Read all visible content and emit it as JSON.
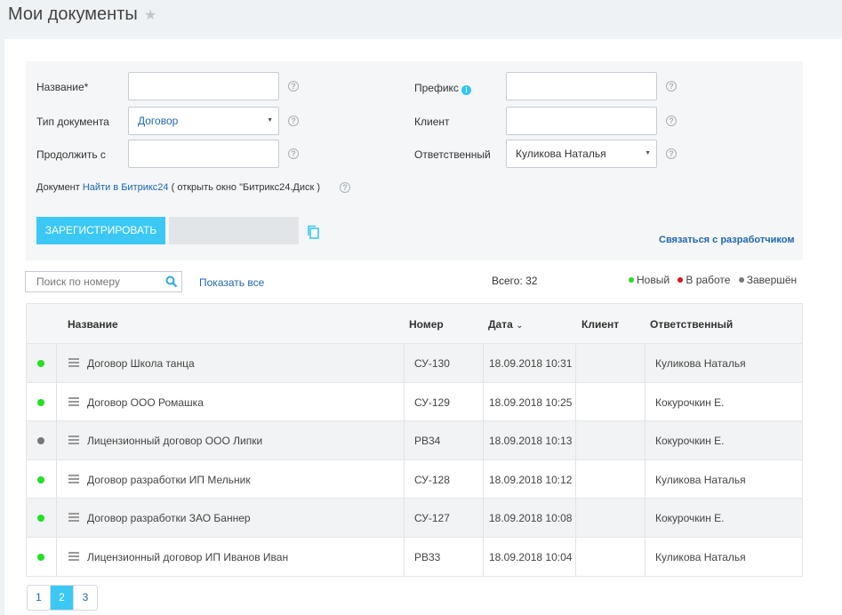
{
  "header": {
    "title": "Мои документы"
  },
  "form": {
    "name_label": "Название*",
    "name_value": "",
    "doc_type_label": "Тип документа",
    "doc_type_value": "Договор",
    "continue_label": "Продолжить с",
    "continue_value": "",
    "prefix_label": "Префикс",
    "prefix_value": "",
    "client_label": "Клиент",
    "client_value": "",
    "responsible_label": "Ответственный",
    "responsible_value": "Куликова Наталья",
    "document_label": "Документ",
    "find_link": "Найти в Битрикс24",
    "open_window_text": "( открыть окно \"Битрикс24.Диск )",
    "register_button": "ЗАРЕГИСТРИРОВАТЬ",
    "contact_link": "Связаться с разработчиком"
  },
  "toolbar": {
    "search_placeholder": "Поиск по номеру",
    "show_all": "Показать все",
    "total": "Всего: 32",
    "legend": [
      {
        "label": "Новый",
        "color": "#22e022"
      },
      {
        "label": "В работе",
        "color": "#e0101a"
      },
      {
        "label": "Завершён",
        "color": "#777777"
      }
    ]
  },
  "table": {
    "columns": [
      "Название",
      "Номер",
      "Дата",
      "Клиент",
      "Ответственный"
    ],
    "sort_indicator": "⌄",
    "rows": [
      {
        "status": "#22e022",
        "name": "Договор Школа танца",
        "number": "СУ-130",
        "date": "18.09.2018 10:31",
        "client": "",
        "responsible": "Куликова Наталья"
      },
      {
        "status": "#22e022",
        "name": "Договор ООО Ромашка",
        "number": "СУ-129",
        "date": "18.09.2018 10:25",
        "client": "",
        "responsible": "Кокурочкин Е."
      },
      {
        "status": "#777777",
        "name": "Лицензионный договор ООО Липки",
        "number": "РВ34",
        "date": "18.09.2018 10:13",
        "client": "",
        "responsible": "Кокурочкин Е."
      },
      {
        "status": "#22e022",
        "name": "Договор разработки ИП Мельник",
        "number": "СУ-128",
        "date": "18.09.2018 10:12",
        "client": "",
        "responsible": "Куликова Наталья"
      },
      {
        "status": "#22e022",
        "name": "Договор разработки ЗАО Баннер",
        "number": "СУ-127",
        "date": "18.09.2018 10:08",
        "client": "",
        "responsible": "Кокурочкин Е."
      },
      {
        "status": "#22e022",
        "name": "Лицензионный договор ИП Иванов Иван",
        "number": "РВ33",
        "date": "18.09.2018 10:04",
        "client": "",
        "responsible": "Куликова Наталья"
      }
    ]
  },
  "pagination": {
    "pages": [
      "1",
      "2",
      "3"
    ],
    "current": "2"
  }
}
